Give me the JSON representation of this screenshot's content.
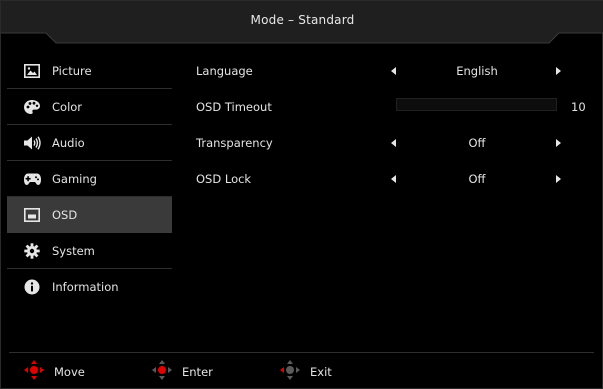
{
  "header": {
    "title": "Mode – Standard"
  },
  "sidebar": {
    "items": [
      {
        "label": "Picture",
        "icon": "picture-icon"
      },
      {
        "label": "Color",
        "icon": "palette-icon"
      },
      {
        "label": "Audio",
        "icon": "speaker-icon"
      },
      {
        "label": "Gaming",
        "icon": "gamepad-icon"
      },
      {
        "label": "OSD",
        "icon": "osd-icon",
        "active": true
      },
      {
        "label": "System",
        "icon": "gear-icon"
      },
      {
        "label": "Information",
        "icon": "info-icon"
      }
    ]
  },
  "settings": {
    "language": {
      "label": "Language",
      "value": "English"
    },
    "osd_timeout": {
      "label": "OSD Timeout",
      "value": "10"
    },
    "transparency": {
      "label": "Transparency",
      "value": "Off"
    },
    "osd_lock": {
      "label": "OSD Lock",
      "value": "Off"
    }
  },
  "footer": {
    "move": {
      "label": "Move",
      "icon": "dpad-move-icon"
    },
    "enter": {
      "label": "Enter",
      "icon": "dpad-enter-icon"
    },
    "exit": {
      "label": "Exit",
      "icon": "dpad-exit-icon"
    }
  },
  "colors": {
    "accent": "#e00000",
    "background": "#000000",
    "selected": "#3a3a3a"
  }
}
